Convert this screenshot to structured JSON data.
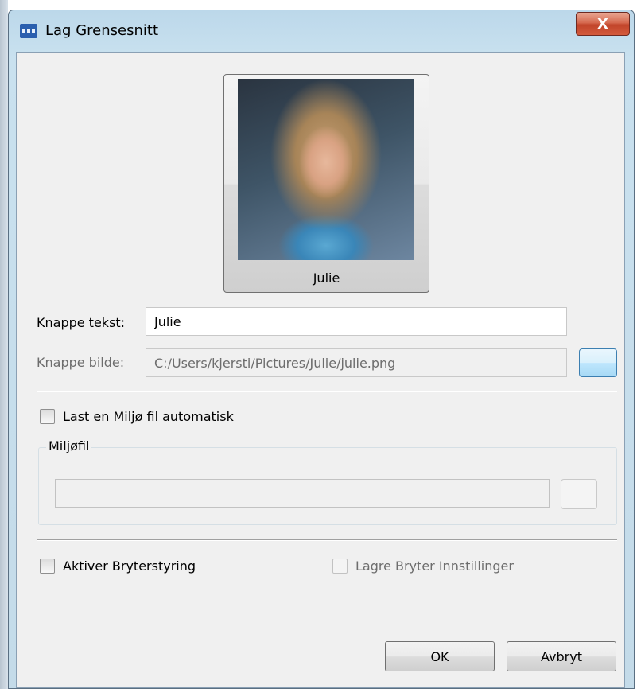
{
  "window": {
    "title": "Lag Grensesnitt",
    "close_label": "X"
  },
  "preview": {
    "label": "Julie"
  },
  "button_text": {
    "label": "Knappe tekst:",
    "value": "Julie"
  },
  "button_image": {
    "label": "Knappe bilde:",
    "value": "C:/Users/kjersti/Pictures/Julie/julie.png"
  },
  "env_autoload": {
    "label": "Last en Miljø fil automatisk",
    "checked": false
  },
  "env_group": {
    "title": "Miljøfil",
    "value": ""
  },
  "switch_control": {
    "label": "Aktiver Bryterstyring",
    "checked": false
  },
  "save_switch_settings": {
    "label": "Lagre Bryter Innstillinger",
    "checked": false,
    "enabled": false
  },
  "footer": {
    "ok_label": "OK",
    "cancel_label": "Avbryt"
  }
}
